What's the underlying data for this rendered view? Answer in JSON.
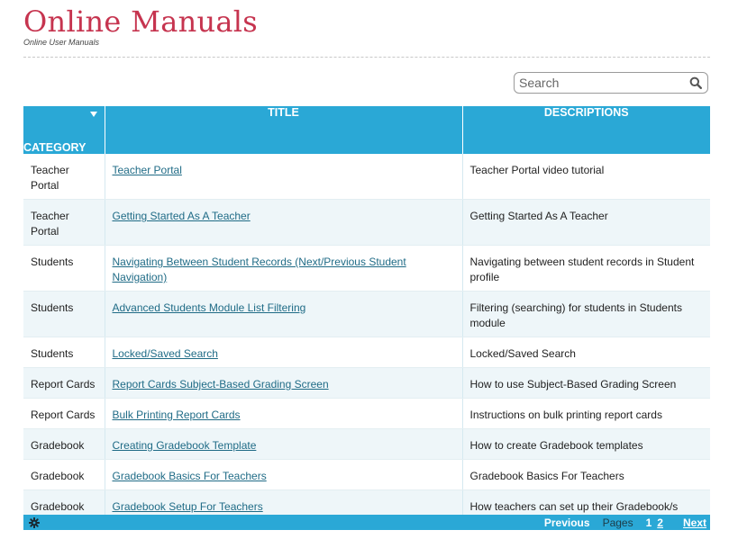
{
  "header": {
    "title": "Online Manuals",
    "subtitle": "Online User Manuals"
  },
  "search": {
    "placeholder": "Search",
    "icon": "magnifier-icon"
  },
  "table": {
    "columns": [
      "CATEGORY",
      "TITLE",
      "DESCRIPTIONS"
    ],
    "rows": [
      {
        "category": "Teacher Portal",
        "title": "Teacher Portal",
        "description": "Teacher Portal video tutorial"
      },
      {
        "category": "Teacher Portal",
        "title": "Getting Started As A Teacher",
        "description": "Getting Started As A Teacher"
      },
      {
        "category": "Students",
        "title": "Navigating Between Student Records (Next/Previous Student Navigation)",
        "description": "Navigating between student records in Student profile"
      },
      {
        "category": "Students",
        "title": "Advanced Students Module List Filtering",
        "description": "Filtering (searching) for students in Students module"
      },
      {
        "category": "Students",
        "title": "Locked/Saved Search",
        "description": "Locked/Saved Search"
      },
      {
        "category": "Report Cards",
        "title": "Report Cards Subject-Based Grading Screen",
        "description": "How to use Subject-Based Grading Screen"
      },
      {
        "category": "Report Cards",
        "title": "Bulk Printing Report Cards",
        "description": "Instructions on bulk printing report cards"
      },
      {
        "category": "Gradebook",
        "title": "Creating Gradebook Template",
        "description": "How to create Gradebook templates"
      },
      {
        "category": "Gradebook",
        "title": "Gradebook Basics For Teachers",
        "description": "Gradebook Basics For Teachers"
      },
      {
        "category": "Gradebook",
        "title": "Gradebook Setup For Teachers",
        "description": "How teachers can set up their Gradebook/s"
      }
    ]
  },
  "pager": {
    "previous": "Previous",
    "label": "Pages",
    "pages": [
      "1",
      "2"
    ],
    "next": "Next"
  },
  "colors": {
    "title": "#c6344f",
    "header_bg": "#2aa8d6",
    "link": "#1f6b86",
    "stripe": "#eef6f9"
  }
}
